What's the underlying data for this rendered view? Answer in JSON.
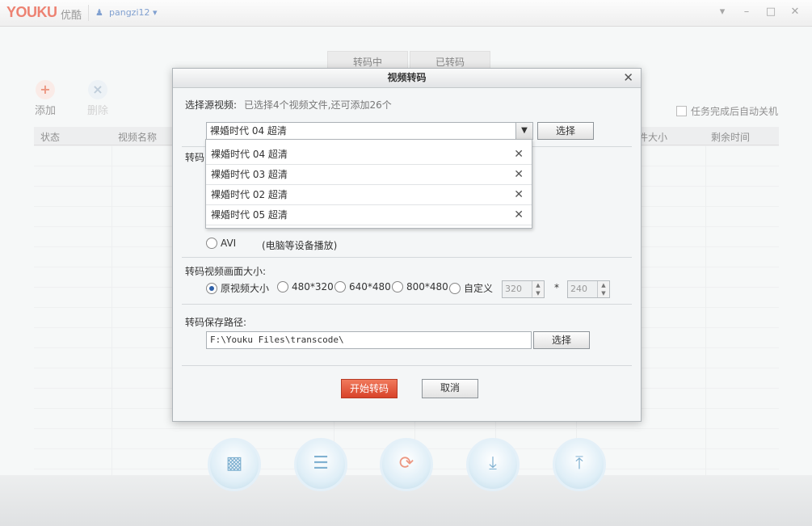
{
  "app": {
    "logo": "YOUKU",
    "logo_cn": "优酷",
    "user": "pangzi12"
  },
  "window_buttons": [
    "▾",
    "–",
    "□",
    "✕"
  ],
  "tabs": [
    {
      "label": "转码中"
    },
    {
      "label": "已转码"
    }
  ],
  "toolbar": {
    "add_label": "添加",
    "delete_label": "删除",
    "auto_shutdown": "任务完成后自动关机"
  },
  "table_headers": [
    "状态",
    "视频名称",
    "件大小",
    "剩余时间"
  ],
  "dialog": {
    "title": "视频转码",
    "source_label": "选择源视频:",
    "source_hint": "已选择4个视频文件,还可添加26个",
    "combo_value": "裸婚时代 04 超清",
    "select_btn": "选择",
    "dropdown_items": [
      "裸婚时代 04 超清",
      "裸婚时代 03 超清",
      "裸婚时代 02 超清",
      "裸婚时代 05 超清"
    ],
    "format_label": "转码",
    "avi_label": "AVI",
    "avi_desc": "(电脑等设备播放)",
    "size_label": "转码视频画面大小:",
    "size_options": [
      "原视频大小",
      "480*320",
      "640*480",
      "800*480",
      "自定义"
    ],
    "custom_w": "320",
    "custom_h": "240",
    "times": "*",
    "path_label": "转码保存路径:",
    "path_value": "F:\\Youku Files\\transcode\\",
    "path_btn": "选择",
    "start_btn": "开始转码",
    "cancel_btn": "取消"
  }
}
